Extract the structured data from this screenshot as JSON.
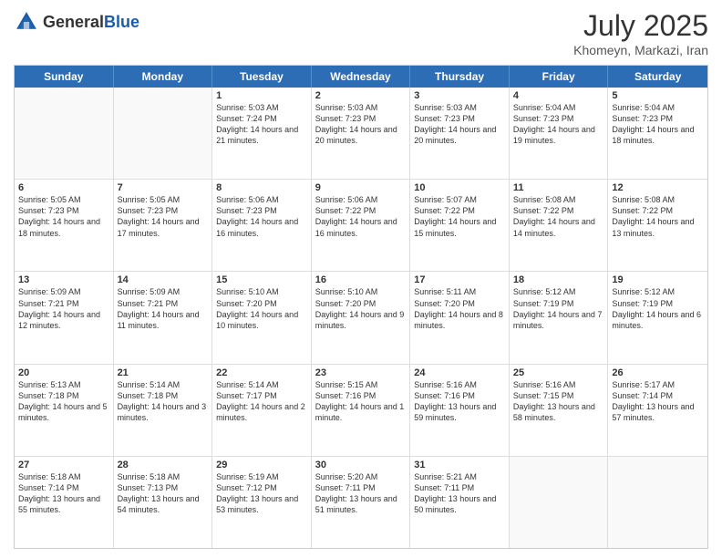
{
  "header": {
    "logo_general": "General",
    "logo_blue": "Blue",
    "month_title": "July 2025",
    "location": "Khomeyn, Markazi, Iran"
  },
  "weekdays": [
    "Sunday",
    "Monday",
    "Tuesday",
    "Wednesday",
    "Thursday",
    "Friday",
    "Saturday"
  ],
  "weeks": [
    [
      {
        "day": "",
        "empty": true
      },
      {
        "day": "",
        "empty": true
      },
      {
        "day": "1",
        "sunrise": "5:03 AM",
        "sunset": "7:24 PM",
        "daylight": "14 hours and 21 minutes."
      },
      {
        "day": "2",
        "sunrise": "5:03 AM",
        "sunset": "7:23 PM",
        "daylight": "14 hours and 20 minutes."
      },
      {
        "day": "3",
        "sunrise": "5:03 AM",
        "sunset": "7:23 PM",
        "daylight": "14 hours and 20 minutes."
      },
      {
        "day": "4",
        "sunrise": "5:04 AM",
        "sunset": "7:23 PM",
        "daylight": "14 hours and 19 minutes."
      },
      {
        "day": "5",
        "sunrise": "5:04 AM",
        "sunset": "7:23 PM",
        "daylight": "14 hours and 18 minutes."
      }
    ],
    [
      {
        "day": "6",
        "sunrise": "5:05 AM",
        "sunset": "7:23 PM",
        "daylight": "14 hours and 18 minutes."
      },
      {
        "day": "7",
        "sunrise": "5:05 AM",
        "sunset": "7:23 PM",
        "daylight": "14 hours and 17 minutes."
      },
      {
        "day": "8",
        "sunrise": "5:06 AM",
        "sunset": "7:23 PM",
        "daylight": "14 hours and 16 minutes."
      },
      {
        "day": "9",
        "sunrise": "5:06 AM",
        "sunset": "7:22 PM",
        "daylight": "14 hours and 16 minutes."
      },
      {
        "day": "10",
        "sunrise": "5:07 AM",
        "sunset": "7:22 PM",
        "daylight": "14 hours and 15 minutes."
      },
      {
        "day": "11",
        "sunrise": "5:08 AM",
        "sunset": "7:22 PM",
        "daylight": "14 hours and 14 minutes."
      },
      {
        "day": "12",
        "sunrise": "5:08 AM",
        "sunset": "7:22 PM",
        "daylight": "14 hours and 13 minutes."
      }
    ],
    [
      {
        "day": "13",
        "sunrise": "5:09 AM",
        "sunset": "7:21 PM",
        "daylight": "14 hours and 12 minutes."
      },
      {
        "day": "14",
        "sunrise": "5:09 AM",
        "sunset": "7:21 PM",
        "daylight": "14 hours and 11 minutes."
      },
      {
        "day": "15",
        "sunrise": "5:10 AM",
        "sunset": "7:20 PM",
        "daylight": "14 hours and 10 minutes."
      },
      {
        "day": "16",
        "sunrise": "5:10 AM",
        "sunset": "7:20 PM",
        "daylight": "14 hours and 9 minutes."
      },
      {
        "day": "17",
        "sunrise": "5:11 AM",
        "sunset": "7:20 PM",
        "daylight": "14 hours and 8 minutes."
      },
      {
        "day": "18",
        "sunrise": "5:12 AM",
        "sunset": "7:19 PM",
        "daylight": "14 hours and 7 minutes."
      },
      {
        "day": "19",
        "sunrise": "5:12 AM",
        "sunset": "7:19 PM",
        "daylight": "14 hours and 6 minutes."
      }
    ],
    [
      {
        "day": "20",
        "sunrise": "5:13 AM",
        "sunset": "7:18 PM",
        "daylight": "14 hours and 5 minutes."
      },
      {
        "day": "21",
        "sunrise": "5:14 AM",
        "sunset": "7:18 PM",
        "daylight": "14 hours and 3 minutes."
      },
      {
        "day": "22",
        "sunrise": "5:14 AM",
        "sunset": "7:17 PM",
        "daylight": "14 hours and 2 minutes."
      },
      {
        "day": "23",
        "sunrise": "5:15 AM",
        "sunset": "7:16 PM",
        "daylight": "14 hours and 1 minute."
      },
      {
        "day": "24",
        "sunrise": "5:16 AM",
        "sunset": "7:16 PM",
        "daylight": "13 hours and 59 minutes."
      },
      {
        "day": "25",
        "sunrise": "5:16 AM",
        "sunset": "7:15 PM",
        "daylight": "13 hours and 58 minutes."
      },
      {
        "day": "26",
        "sunrise": "5:17 AM",
        "sunset": "7:14 PM",
        "daylight": "13 hours and 57 minutes."
      }
    ],
    [
      {
        "day": "27",
        "sunrise": "5:18 AM",
        "sunset": "7:14 PM",
        "daylight": "13 hours and 55 minutes."
      },
      {
        "day": "28",
        "sunrise": "5:18 AM",
        "sunset": "7:13 PM",
        "daylight": "13 hours and 54 minutes."
      },
      {
        "day": "29",
        "sunrise": "5:19 AM",
        "sunset": "7:12 PM",
        "daylight": "13 hours and 53 minutes."
      },
      {
        "day": "30",
        "sunrise": "5:20 AM",
        "sunset": "7:11 PM",
        "daylight": "13 hours and 51 minutes."
      },
      {
        "day": "31",
        "sunrise": "5:21 AM",
        "sunset": "7:11 PM",
        "daylight": "13 hours and 50 minutes."
      },
      {
        "day": "",
        "empty": true
      },
      {
        "day": "",
        "empty": true
      }
    ]
  ]
}
